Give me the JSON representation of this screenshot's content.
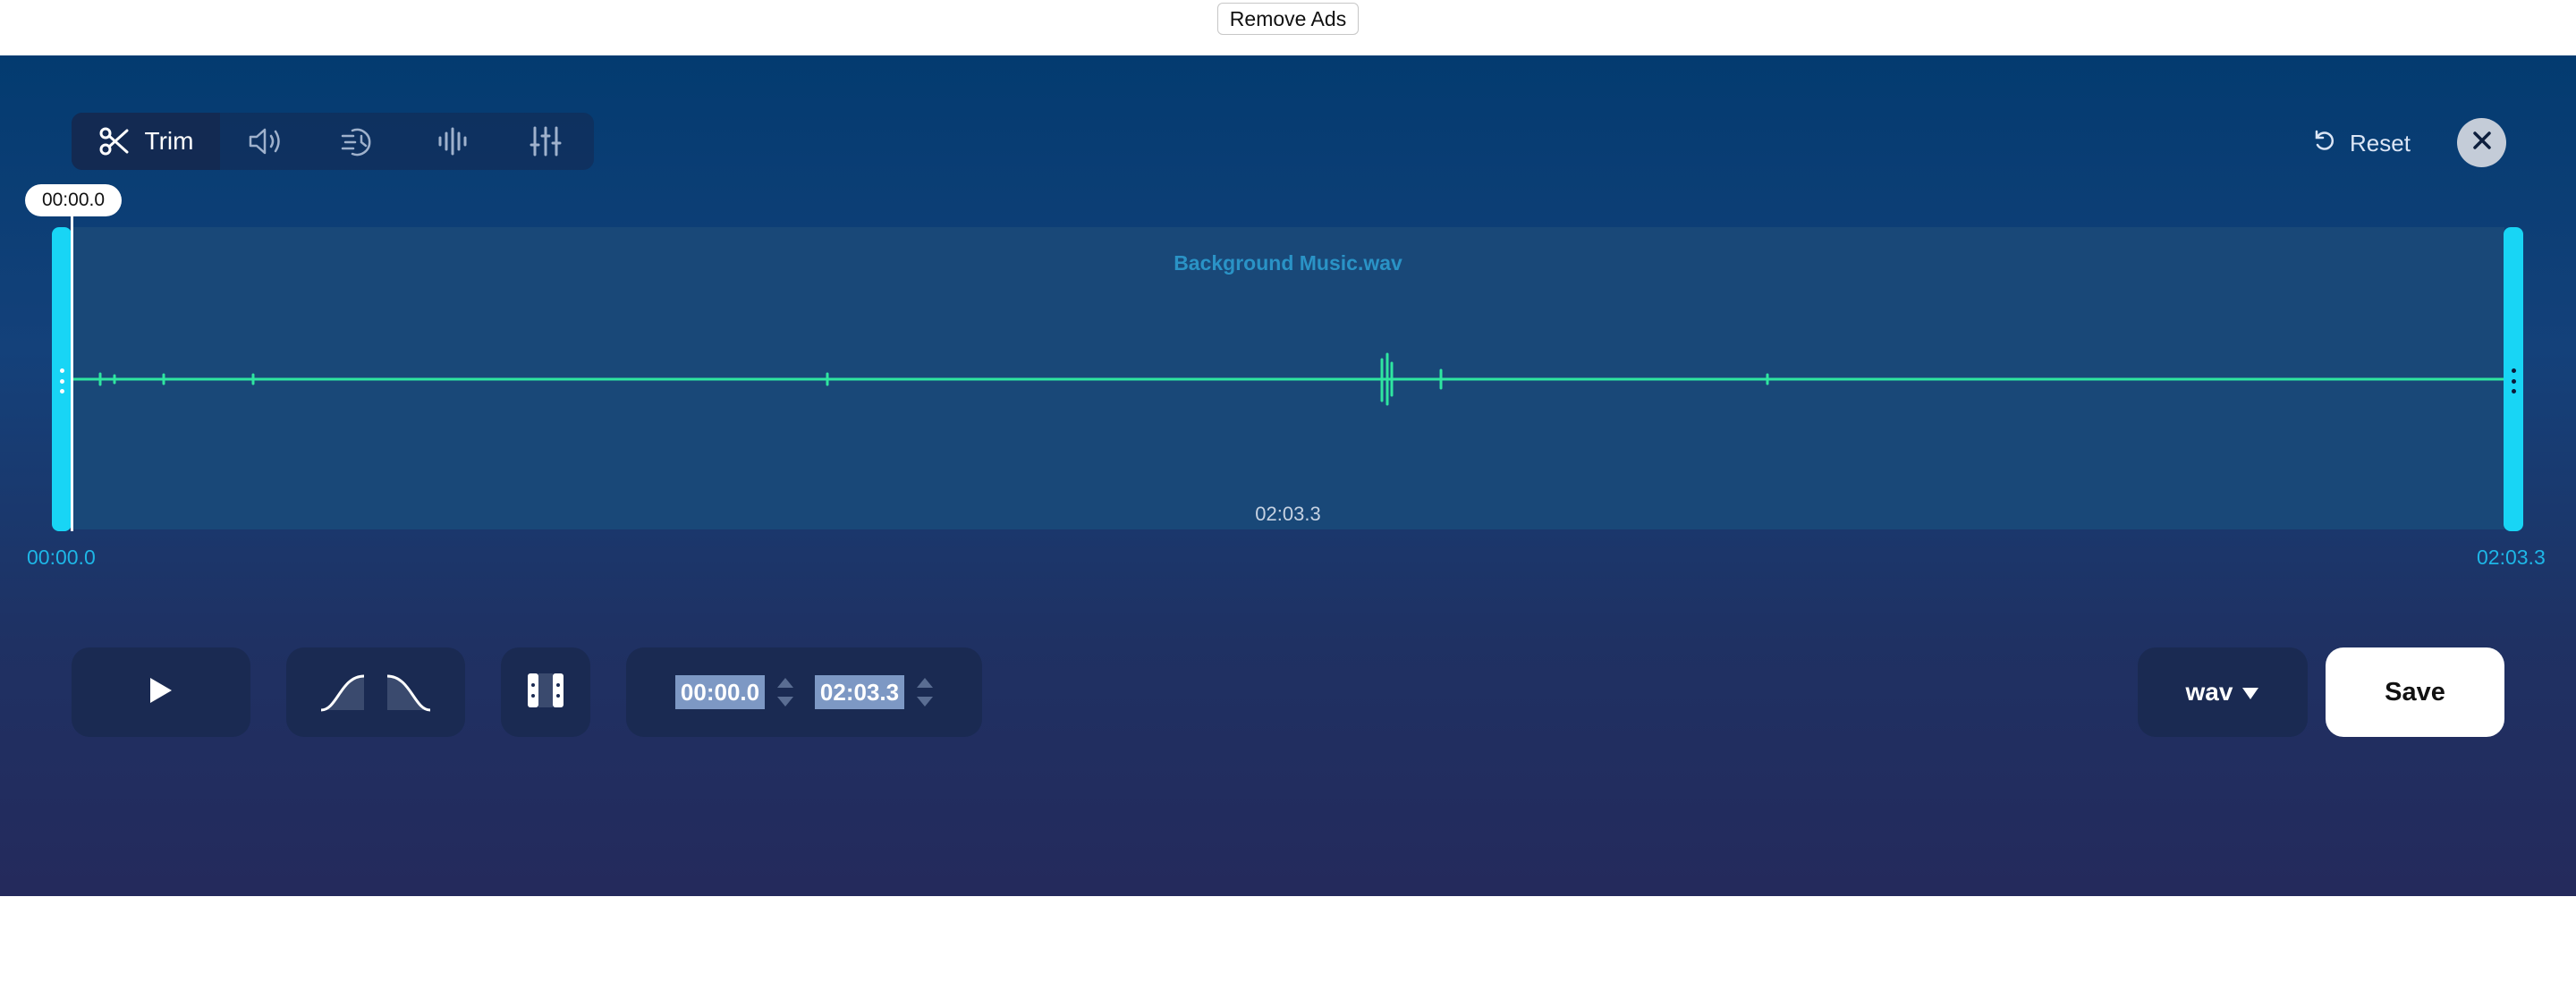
{
  "top_bar": {
    "remove_ads_label": "Remove Ads"
  },
  "toolbar": {
    "tools": [
      {
        "label": "Trim",
        "icon": "scissors-icon",
        "active": true
      },
      {
        "label": "",
        "icon": "volume-icon",
        "active": false
      },
      {
        "label": "",
        "icon": "speed-icon",
        "active": false
      },
      {
        "label": "",
        "icon": "waveform-icon",
        "active": false
      },
      {
        "label": "",
        "icon": "equalizer-icon",
        "active": false
      }
    ],
    "reset_label": "Reset",
    "reset_icon": "undo-icon",
    "close_icon": "close-icon"
  },
  "waveform": {
    "file_name": "Background Music.wav",
    "duration": "02:03.3",
    "playhead_time": "00:00.0",
    "start_time": "00:00.0",
    "end_time": "02:03.3",
    "wave_color": "#2fe6a0",
    "handle_color": "#18d5f5"
  },
  "controls": {
    "play_icon": "play-icon",
    "fade_in_icon": "fade-in-icon",
    "fade_out_icon": "fade-out-icon",
    "split_icon": "split-icon",
    "start_input": "00:00.0",
    "end_input": "02:03.3",
    "format_value": "wav",
    "save_label": "Save"
  },
  "colors": {
    "background_top": "#033b70",
    "background_bottom": "#242a5c",
    "panel": "#1a2a52",
    "accent": "#1eb6e6"
  }
}
